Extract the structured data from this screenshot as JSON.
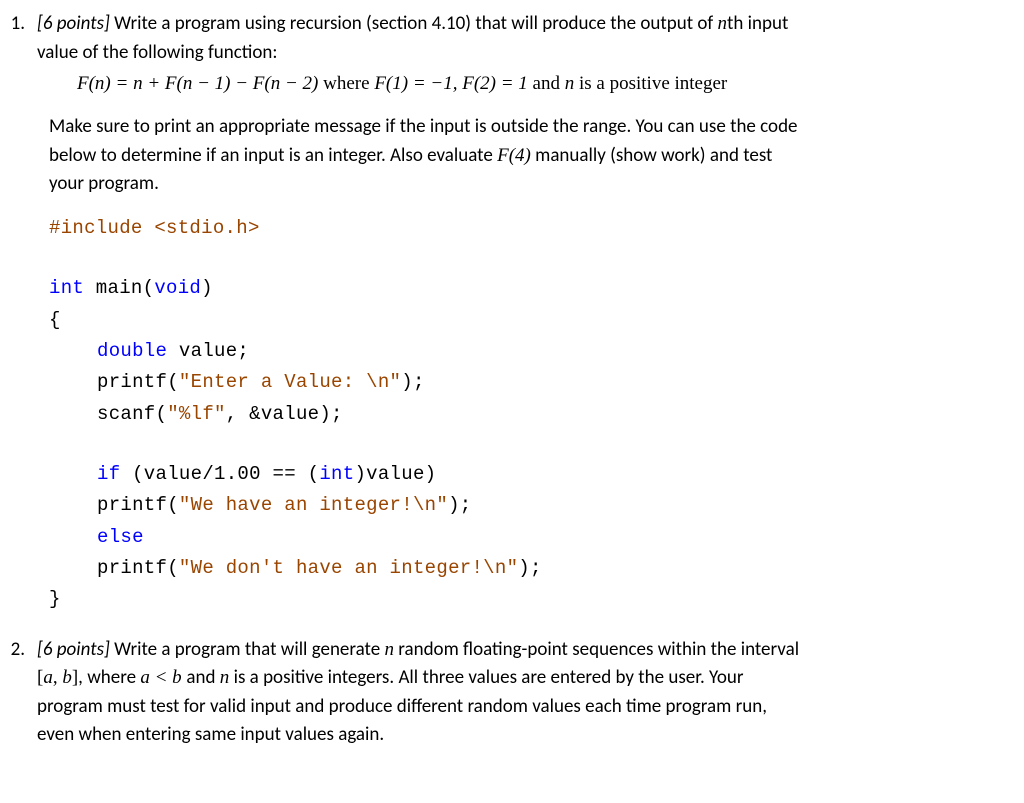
{
  "q1": {
    "num": "1.",
    "points_label": "[6 points]",
    "text1": " Write a program using recursion (section 4.10) that will produce the output of ",
    "nth": "n",
    "text1b": "th input",
    "text2": "value of the following function:",
    "formula_part1": "F(n) = n + F(n − 1) − F(n − 2)",
    "formula_where": " where ",
    "formula_part2": "F(1) = −1,  F(2) = 1",
    "formula_and": " and  ",
    "formula_n": "n",
    "formula_end": " is a positive integer",
    "para2a": "Make sure to print an appropriate message if the input is outside the range.  You can use the code",
    "para2b": "below to determine if an input is an integer.  Also evaluate ",
    "f4": "F(4)",
    "para2c": " manually (show work) and test",
    "para2d": "your program."
  },
  "code": {
    "l1a": "#include ",
    "l1b": "<stdio.h>",
    "l2a": "int",
    "l2b": " main(",
    "l2c": "void",
    "l2d": ")",
    "l3": "{",
    "l4a": "double",
    "l4b": " value;",
    "l5a": "printf(",
    "l5b": "\"Enter a Value: \\n\"",
    "l5c": ");",
    "l6a": "scanf(",
    "l6b": "\"%lf\"",
    "l6c": ", &value);",
    "l7a": "if",
    "l7b": " (value/1.00 == (",
    "l7c": "int",
    "l7d": ")value)",
    "l8a": "printf(",
    "l8b": "\"We have an integer!\\n\"",
    "l8c": ");",
    "l9": "else",
    "l10a": "printf(",
    "l10b": "\"We don't have an integer!\\n\"",
    "l10c": ");",
    "l11": "}"
  },
  "q2": {
    "num": "2.",
    "points_label": "[6 points]",
    "text1": " Write a program that will generate ",
    "n": "n",
    "text1b": " random floating-point sequences within the interval",
    "text2a": "[a, b]",
    "text2b": ", where ",
    "text2c": "a <  b ",
    "text2d": " and ",
    "text2e": "n",
    "text2f": " is a positive integers.  All three values are entered by the user.  Your",
    "text3": "program must test for valid input and produce different random values each time program run,",
    "text4": "even when entering same input values again."
  }
}
